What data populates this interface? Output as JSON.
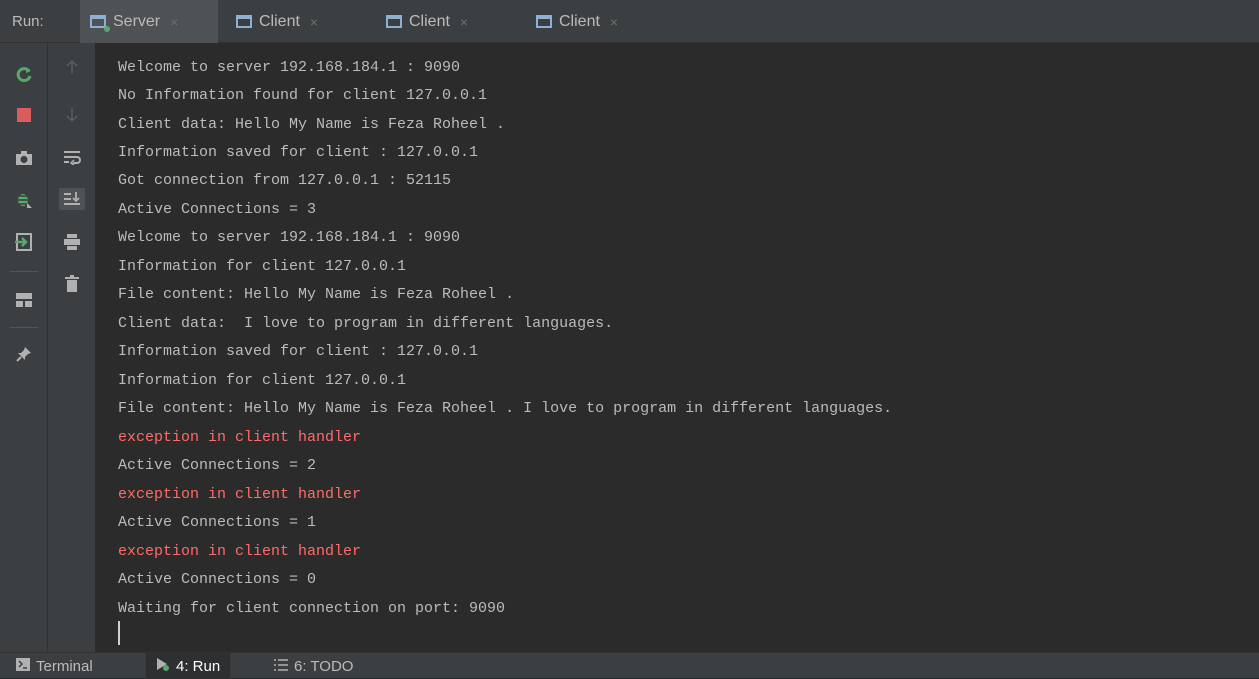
{
  "runbar": {
    "label": "Run:",
    "tabs": [
      {
        "label": "Server",
        "close": "×"
      },
      {
        "label": "Client",
        "close": "×"
      },
      {
        "label": "Client",
        "close": "×"
      },
      {
        "label": "Client",
        "close": "×"
      }
    ]
  },
  "console": {
    "lines": [
      {
        "text": "Welcome to server 192.168.184.1 : 9090",
        "type": "out"
      },
      {
        "text": "No Information found for client 127.0.0.1",
        "type": "out"
      },
      {
        "text": "Client data: Hello My Name is Feza Roheel .",
        "type": "out"
      },
      {
        "text": "Information saved for client : 127.0.0.1",
        "type": "out"
      },
      {
        "text": "Got connection from 127.0.0.1 : 52115",
        "type": "out"
      },
      {
        "text": "Active Connections = 3",
        "type": "out"
      },
      {
        "text": "Welcome to server 192.168.184.1 : 9090",
        "type": "out"
      },
      {
        "text": "Information for client 127.0.0.1",
        "type": "out"
      },
      {
        "text": "File content: Hello My Name is Feza Roheel .",
        "type": "out"
      },
      {
        "text": "Client data:  I love to program in different languages.",
        "type": "out"
      },
      {
        "text": "Information saved for client : 127.0.0.1",
        "type": "out"
      },
      {
        "text": "Information for client 127.0.0.1",
        "type": "out"
      },
      {
        "text": "File content: Hello My Name is Feza Roheel . I love to program in different languages.",
        "type": "out"
      },
      {
        "text": "exception in client handler",
        "type": "err"
      },
      {
        "text": "Active Connections = 2",
        "type": "out"
      },
      {
        "text": "exception in client handler",
        "type": "err"
      },
      {
        "text": "Active Connections = 1",
        "type": "out"
      },
      {
        "text": "exception in client handler",
        "type": "err"
      },
      {
        "text": "Active Connections = 0",
        "type": "out"
      },
      {
        "text": "Waiting for client connection on port: 9090",
        "type": "out"
      }
    ]
  },
  "bottombar": {
    "terminal": "Terminal",
    "run": "4: Run",
    "todo": "6: TODO"
  },
  "colors": {
    "background": "#2b2b2b",
    "panel": "#3c3f41",
    "text": "#bbbbbb",
    "error": "#ff6b68",
    "rerun_green": "#59a869",
    "stop_red": "#db5c5c"
  },
  "icons": {
    "gutter1": [
      "rerun-icon",
      "stop-icon",
      "camera-icon",
      "debug-icon",
      "exit-icon",
      "layout-icon",
      "pin-icon"
    ],
    "gutter2": [
      "up-arrow-icon",
      "down-arrow-icon",
      "soft-wrap-icon",
      "scroll-to-end-icon",
      "print-icon",
      "trash-icon"
    ]
  }
}
